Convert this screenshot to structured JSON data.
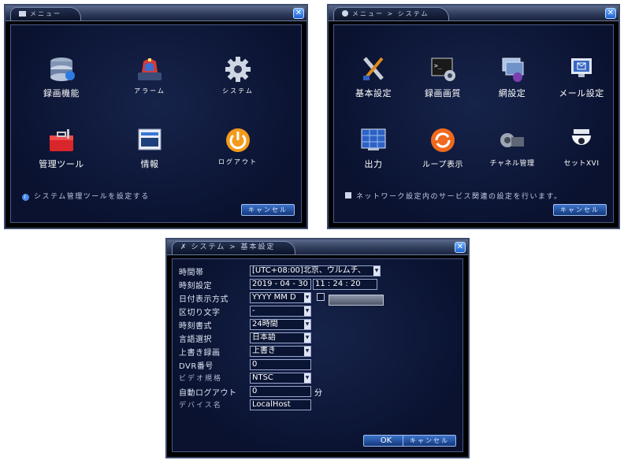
{
  "menu_window": {
    "title": "メニュー",
    "items": [
      {
        "label": "録画機能",
        "icon": "recording-icon"
      },
      {
        "label": "アラーム",
        "icon": "alarm-icon"
      },
      {
        "label": "システム",
        "icon": "system-gear-icon"
      },
      {
        "label": "管理ツール",
        "icon": "toolbox-icon"
      },
      {
        "label": "情報",
        "icon": "info-monitor-icon"
      },
      {
        "label": "ログアウト",
        "icon": "power-icon"
      }
    ],
    "hint": "システム管理ツールを設定する",
    "cancel_label": "キャンセル"
  },
  "system_window": {
    "title": "メニュー > システム",
    "items": [
      {
        "label": "基本設定",
        "icon": "wrench-screwdriver-icon"
      },
      {
        "label": "録画画質",
        "icon": "terminal-gear-icon"
      },
      {
        "label": "網設定",
        "icon": "network-icon"
      },
      {
        "label": "メール設定",
        "icon": "email-monitor-icon"
      },
      {
        "label": "出力",
        "icon": "display-grid-icon"
      },
      {
        "label": "ループ表示",
        "icon": "loop-icon"
      },
      {
        "label": "チャネル管理",
        "icon": "camera-gear-icon"
      },
      {
        "label": "セットXVI",
        "icon": "dome-camera-icon"
      }
    ],
    "hint": "ネットワーク設定内のサービス関連の設定を行います。",
    "cancel_label": "キャンセル"
  },
  "basic_window": {
    "title": "システム > 基本設定",
    "fields": [
      {
        "label": "時間帯",
        "value": "[UTC+08:00]北京、ウルムチ、",
        "type": "select"
      },
      {
        "label": "時刻設定",
        "value": "2019 - 04 - 30",
        "time": "11 : 24 : 20",
        "type": "datetime"
      },
      {
        "label": "日付表示方式",
        "value": "YYYY MM D",
        "type": "select"
      },
      {
        "label": "区切り文字",
        "value": "-",
        "type": "select"
      },
      {
        "label": "時刻書式",
        "value": "24時間",
        "type": "select"
      },
      {
        "label": "言語選択",
        "value": "日本語",
        "type": "select"
      },
      {
        "label": "上書き録画",
        "value": "上書き",
        "type": "select"
      },
      {
        "label": "DVR番号",
        "value": "0",
        "type": "text"
      },
      {
        "label": "ビデオ規格",
        "value": "NTSC",
        "type": "select"
      },
      {
        "label": "自動ログアウト",
        "value": "0",
        "unit": "分",
        "type": "text"
      },
      {
        "label": "デバイス名",
        "value": "LocalHost",
        "type": "text"
      }
    ],
    "ok_label": "OK",
    "cancel_label": "キャンセル"
  },
  "colors": {
    "accent_blue": "#1d63d1",
    "panel_dark": "#0a1230",
    "frame": "#3b4a6a"
  }
}
